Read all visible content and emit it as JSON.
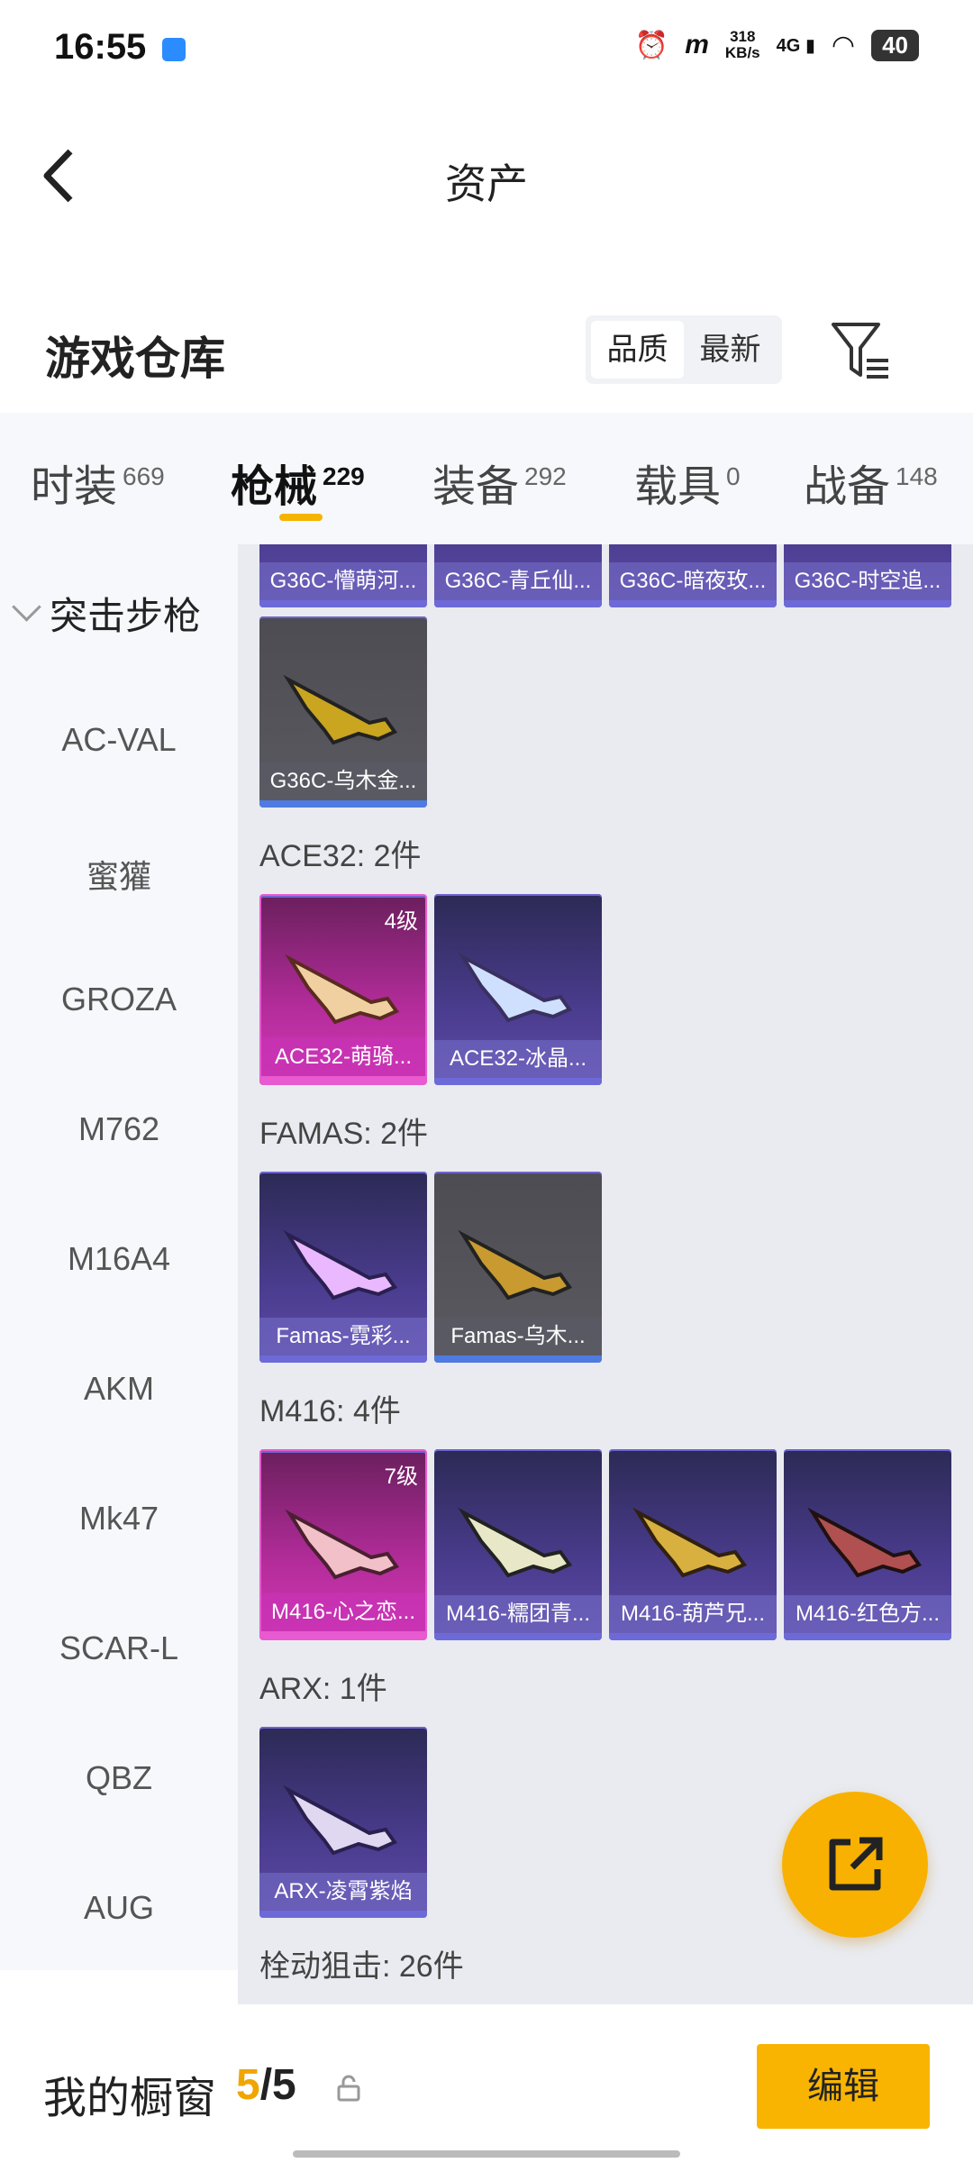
{
  "status": {
    "time": "16:55",
    "net_value": "318",
    "net_unit": "KB/s",
    "signal": "4G",
    "battery": "40"
  },
  "header": {
    "title": "资产"
  },
  "warehouse": {
    "title": "游戏仓库",
    "sort_quality": "品质",
    "sort_latest": "最新"
  },
  "tabs": [
    {
      "label": "时装",
      "count": "669"
    },
    {
      "label": "枪械",
      "count": "229"
    },
    {
      "label": "装备",
      "count": "292"
    },
    {
      "label": "载具",
      "count": "0"
    },
    {
      "label": "战备",
      "count": "148"
    }
  ],
  "sidebar": {
    "category": "突击步枪",
    "items": [
      "AC-VAL",
      "蜜獾",
      "GROZA",
      "M762",
      "M16A4",
      "AKM",
      "Mk47",
      "SCAR-L",
      "QBZ",
      "AUG"
    ]
  },
  "groups": {
    "g36c_top": [
      "G36C-懵萌河...",
      "G36C-青丘仙...",
      "G36C-暗夜玫...",
      "G36C-时空追..."
    ],
    "g36c_more": "G36C-乌木金...",
    "ace32": {
      "title": "ACE32: 2件",
      "items": [
        "ACE32-萌骑...",
        "ACE32-冰晶..."
      ],
      "level": "4级"
    },
    "famas": {
      "title": "FAMAS: 2件",
      "items": [
        "Famas-霓彩...",
        "Famas-乌木..."
      ]
    },
    "m416": {
      "title": "M416: 4件",
      "items": [
        "M416-心之恋...",
        "M416-糯团青...",
        "M416-葫芦兄...",
        "M416-红色方..."
      ],
      "level": "7级"
    },
    "arx": {
      "title": "ARX: 1件",
      "items": [
        "ARX-凌霄紫焰"
      ]
    },
    "sniper": {
      "title": "栓动狙击: 26件"
    }
  },
  "bottom": {
    "label": "我的橱窗",
    "current": "5",
    "total": "/5",
    "edit": "编辑"
  }
}
